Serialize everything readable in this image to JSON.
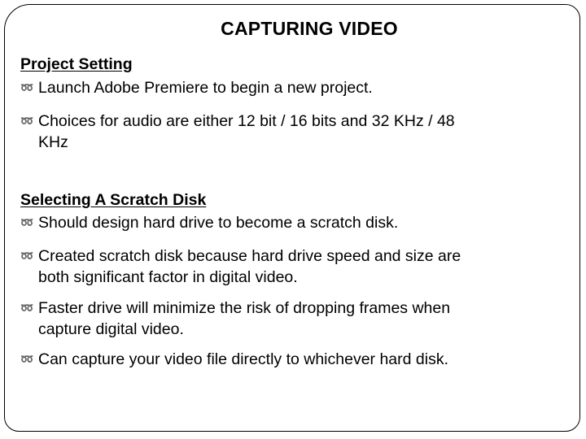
{
  "slide": {
    "title": "CAPTURING VIDEO",
    "bullet_icon": "curly-loop-bullet-icon",
    "bullet_color": "#d4b830",
    "sections": [
      {
        "heading": "Project Setting",
        "items": [
          {
            "lines": [
              "Launch Adobe Premiere to begin a new project."
            ]
          },
          {
            "lines": [
              "Choices for audio are either 12 bit / 16 bits and 32 KHz / 48",
              "KHz"
            ]
          }
        ]
      },
      {
        "heading": "Selecting A Scratch Disk",
        "items": [
          {
            "lines": [
              "Should design hard drive to become a scratch disk."
            ]
          },
          {
            "lines": [
              "Created scratch disk because hard drive speed and size are",
              "both significant factor in digital video."
            ]
          },
          {
            "lines": [
              "Faster drive will minimize the risk of dropping frames when",
              "capture digital video."
            ]
          },
          {
            "lines": [
              "Can capture your video file directly to whichever hard disk."
            ]
          }
        ]
      }
    ]
  }
}
